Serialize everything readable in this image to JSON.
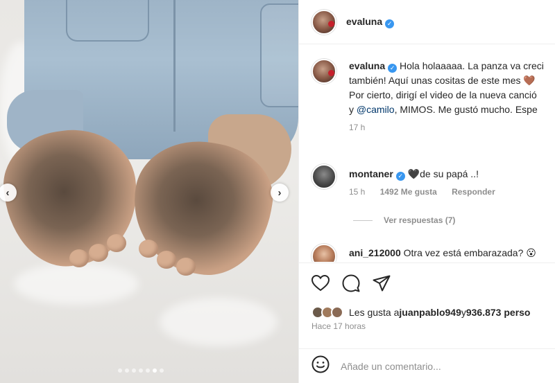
{
  "post": {
    "author": "evaluna",
    "verified_icon": "verified-badge-icon",
    "carousel": {
      "total_slides": 7,
      "active_slide": 6
    }
  },
  "caption": {
    "username": "evaluna",
    "line1": "Hola holaaaaa. La panza va creci",
    "line2": "también! Aquí unas cositas de este mes 🤎",
    "line3": "Por cierto, dirigí el video de la nueva canció",
    "line4_prefix": "y ",
    "mention": "@camilo",
    "line4_suffix": ", MIMOS. Me gustó mucho. Espe",
    "time": "17 h"
  },
  "comments": [
    {
      "username": "montaner",
      "text": "🖤de su papá ..!",
      "time": "15 h",
      "likes": "1492 Me gusta",
      "reply": "Responder",
      "view_replies": "Ver respuestas (7)"
    },
    {
      "username": "ani_212000",
      "text": "Otra vez está embarazada? 😮"
    }
  ],
  "actions": {
    "like_icon": "heart-icon",
    "comment_icon": "comment-icon",
    "share_icon": "send-icon"
  },
  "likes": {
    "prefix": "Les gusta a ",
    "user": "juanpablo949",
    "middle": " y ",
    "count": "936.873 perso"
  },
  "posted": "Hace 17 horas",
  "add_comment": {
    "placeholder": "Añade un comentario...",
    "emoji_icon": "emoji-icon"
  },
  "colors": {
    "link": "#00376b",
    "verified": "#3897f0",
    "muted": "#8e8e8e"
  }
}
